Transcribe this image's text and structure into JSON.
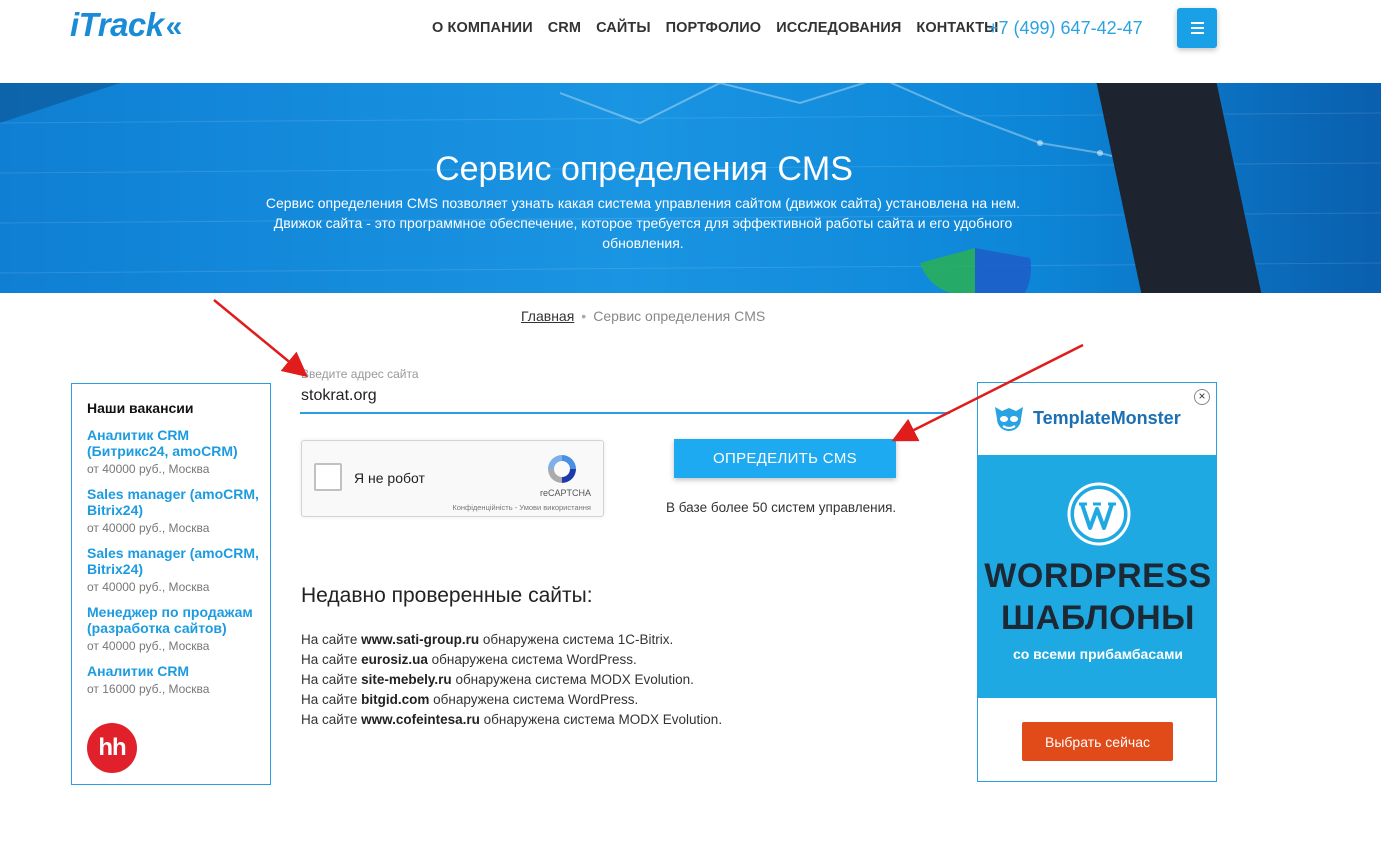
{
  "header": {
    "logo": "iTrack",
    "logo_mark": "«",
    "nav": [
      "О КОМПАНИИ",
      "CRM",
      "САЙТЫ",
      "ПОРТФОЛИО",
      "ИССЛЕДОВАНИЯ",
      "КОНТАКТЫ"
    ],
    "phone": "+7 (499) 647-42-47",
    "menu_icon": "hamburger-icon"
  },
  "hero": {
    "title": "Сервис определения CMS",
    "description": "Сервис определения CMS позволяет узнать какая система управления сайтом (движок сайта) установлена на нем. Движок сайта - это программное обеспечение, которое требуется для эффективной работы сайта и его удобного обновления."
  },
  "breadcrumb": {
    "home": "Главная",
    "separator": "•",
    "current": "Сервис определения CMS"
  },
  "vacancies": {
    "heading": "Наши вакансии",
    "items": [
      {
        "title": "Аналитик CRM (Битрикс24, amoCRM)",
        "meta": "от 40000 руб., Москва"
      },
      {
        "title": "Sales manager (amoCRM, Bitrix24)",
        "meta": "от 40000 руб., Москва"
      },
      {
        "title": "Sales manager (amoCRM, Bitrix24)",
        "meta": "от 40000 руб., Москва"
      },
      {
        "title": "Менеджер по продажам (разработка сайтов)",
        "meta": "от 40000 руб., Москва"
      },
      {
        "title": "Аналитик CRM",
        "meta": "от 16000 руб., Москва"
      }
    ],
    "hh_logo": "hh"
  },
  "form": {
    "label": "Введите адрес сайта",
    "value": "stokrat.org",
    "captcha_label": "Я не робот",
    "captcha_brand": "reCAPTCHA",
    "captcha_terms": "Конфіденційність - Умови використання",
    "submit": "ОПРЕДЕЛИТЬ CMS",
    "note": "В базе более 50 систем управления."
  },
  "recent": {
    "heading": "Недавно проверенные сайты:",
    "prefix": "На сайте",
    "middle": "обнаружена система",
    "items": [
      {
        "site": "www.sati-group.ru",
        "cms": "1C-Bitrix."
      },
      {
        "site": "eurosiz.ua",
        "cms": "WordPress."
      },
      {
        "site": "site-mebely.ru",
        "cms": "MODX Evolution."
      },
      {
        "site": "bitgid.com",
        "cms": "WordPress."
      },
      {
        "site": "www.cofeintesa.ru",
        "cms": "MODX Evolution."
      }
    ]
  },
  "ad": {
    "brand_a": "Template",
    "brand_b": "Monster",
    "title_line1": "WORDPRESS",
    "title_line2": "ШАБЛОНЫ",
    "subtitle": "со всеми прибамбасами",
    "button": "Выбрать сейчас",
    "close": "×"
  },
  "colors": {
    "accent": "#1da0e6",
    "ad_band": "#1fa9e2",
    "ad_button": "#e14a19",
    "arrow": "#e01c1c"
  }
}
